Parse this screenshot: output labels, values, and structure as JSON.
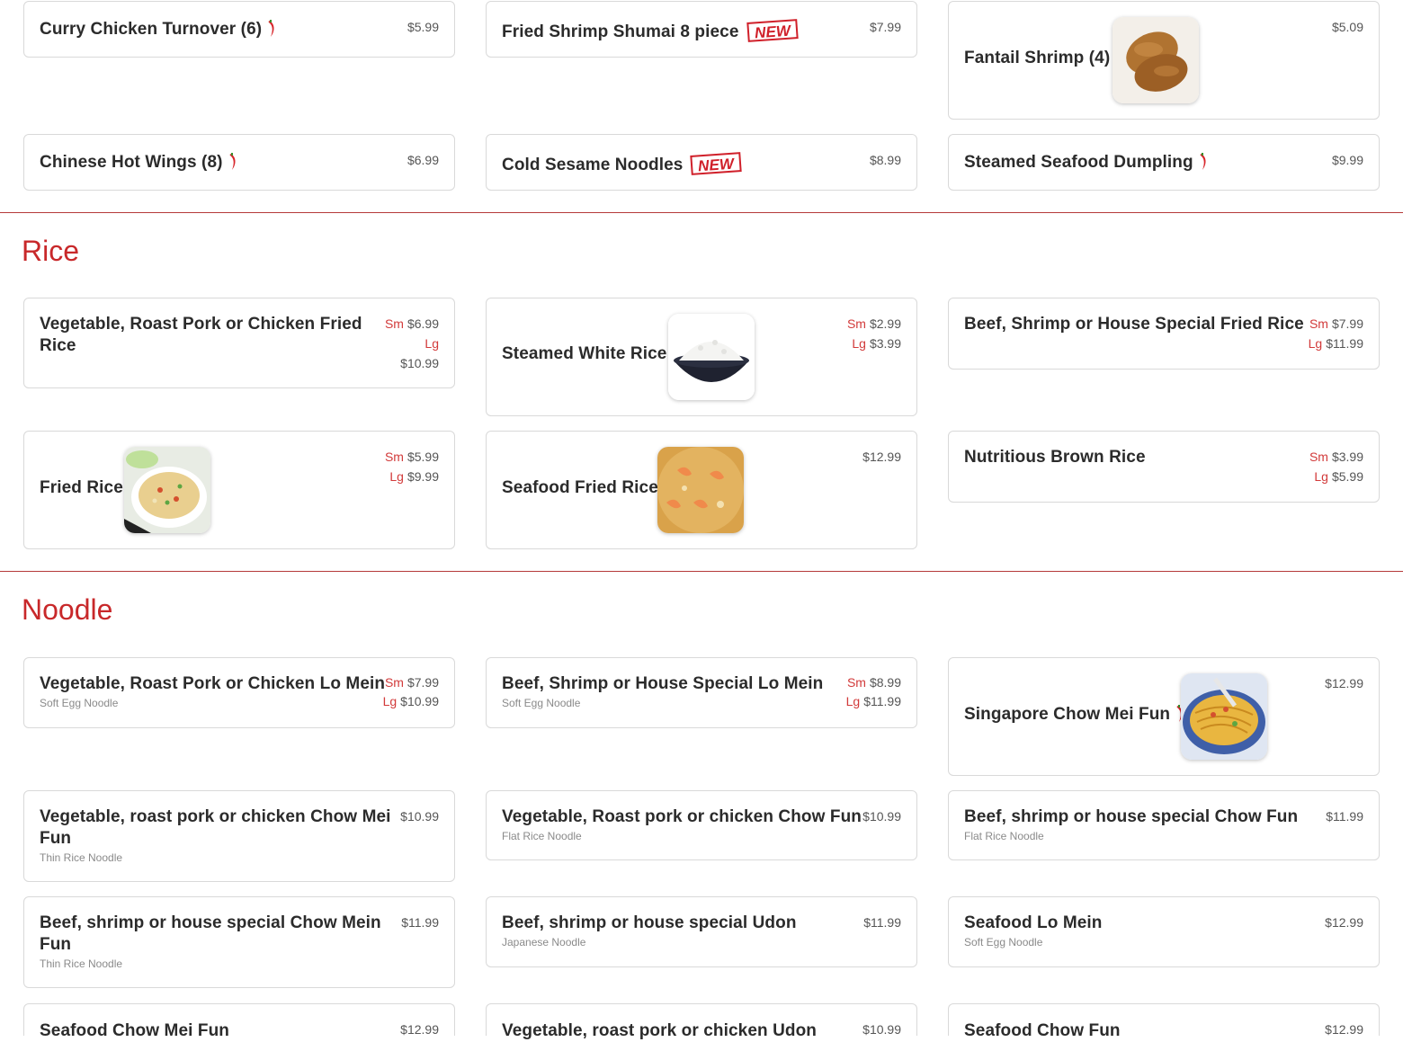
{
  "accent_color": "#c8282a",
  "appetizers": {
    "items": [
      {
        "name": "Curry Chicken Turnover (6)",
        "price": "$5.99",
        "spicy": true
      },
      {
        "name": "Fried Shrimp Shumai 8 piece",
        "price": "$7.99",
        "badge": "NEW"
      },
      {
        "name": "Fantail Shrimp (4)",
        "price": "$5.09",
        "image": "fantail-shrimp-photo"
      },
      {
        "name": "Chinese Hot Wings (8)",
        "price": "$6.99",
        "spicy": true
      },
      {
        "name": "Cold Sesame Noodles",
        "price": "$8.99",
        "badge": "NEW"
      },
      {
        "name": "Steamed Seafood Dumpling",
        "price": "$9.99",
        "spicy": true
      }
    ]
  },
  "rice": {
    "title": "Rice",
    "items": [
      {
        "name_line1": "Vegetable, Roast Pork or Chicken Fried",
        "name_line2": "Rice",
        "sm_label": "Sm",
        "sm_price": "$6.99",
        "lg_label": "Lg",
        "lg_price": "$10.99"
      },
      {
        "name": "Steamed White Rice",
        "sm_label": "Sm",
        "sm_price": "$2.99",
        "lg_label": "Lg",
        "lg_price": "$3.99",
        "image": "white-rice-photo"
      },
      {
        "name": "Beef, Shrimp or House Special Fried Rice",
        "sm_label": "Sm",
        "sm_price": "$7.99",
        "lg_label": "Lg",
        "lg_price": "$11.99"
      },
      {
        "name": "Fried Rice",
        "sm_label": "Sm",
        "sm_price": "$5.99",
        "lg_label": "Lg",
        "lg_price": "$9.99",
        "image": "fried-rice-photo"
      },
      {
        "name": "Seafood Fried Rice",
        "price": "$12.99",
        "image": "seafood-fried-rice-photo"
      },
      {
        "name": "Nutritious Brown Rice",
        "sm_label": "Sm",
        "sm_price": "$3.99",
        "lg_label": "Lg",
        "lg_price": "$5.99"
      }
    ]
  },
  "noodle": {
    "title": "Noodle",
    "items": [
      {
        "name": "Vegetable, Roast Pork or Chicken Lo Mein",
        "sub": "Soft Egg Noodle",
        "sm_label": "Sm",
        "sm_price": "$7.99",
        "lg_label": "Lg",
        "lg_price": "$10.99"
      },
      {
        "name": "Beef, Shrimp or House Special Lo Mein",
        "sub": "Soft Egg Noodle",
        "sm_label": "Sm",
        "sm_price": "$8.99",
        "lg_label": "Lg",
        "lg_price": "$11.99"
      },
      {
        "name": "Singapore Chow Mei Fun",
        "price": "$12.99",
        "spicy": true,
        "image": "singapore-noodle-photo"
      },
      {
        "name_line1": "Vegetable, roast pork or chicken Chow Mei",
        "name_line2": "Fun",
        "sub": "Thin Rice Noodle",
        "price": "$10.99"
      },
      {
        "name": "Vegetable, Roast pork or chicken Chow Fun",
        "sub": "Flat Rice Noodle",
        "price": "$10.99"
      },
      {
        "name": "Beef, shrimp or house special Chow Fun",
        "sub": "Flat Rice Noodle",
        "price": "$11.99"
      },
      {
        "name_line1": "Beef, shrimp or house special Chow Mein",
        "name_line2": "Fun",
        "sub": "Thin Rice Noodle",
        "price": "$11.99"
      },
      {
        "name": "Beef, shrimp or house special Udon",
        "sub": "Japanese Noodle",
        "price": "$11.99"
      },
      {
        "name": "Seafood Lo Mein",
        "sub": "Soft Egg Noodle",
        "price": "$12.99"
      },
      {
        "name": "Seafood Chow Mei Fun",
        "price": "$12.99"
      },
      {
        "name": "Vegetable, roast pork or chicken Udon",
        "price": "$10.99"
      },
      {
        "name": "Seafood Chow Fun",
        "price": "$12.99"
      }
    ]
  }
}
